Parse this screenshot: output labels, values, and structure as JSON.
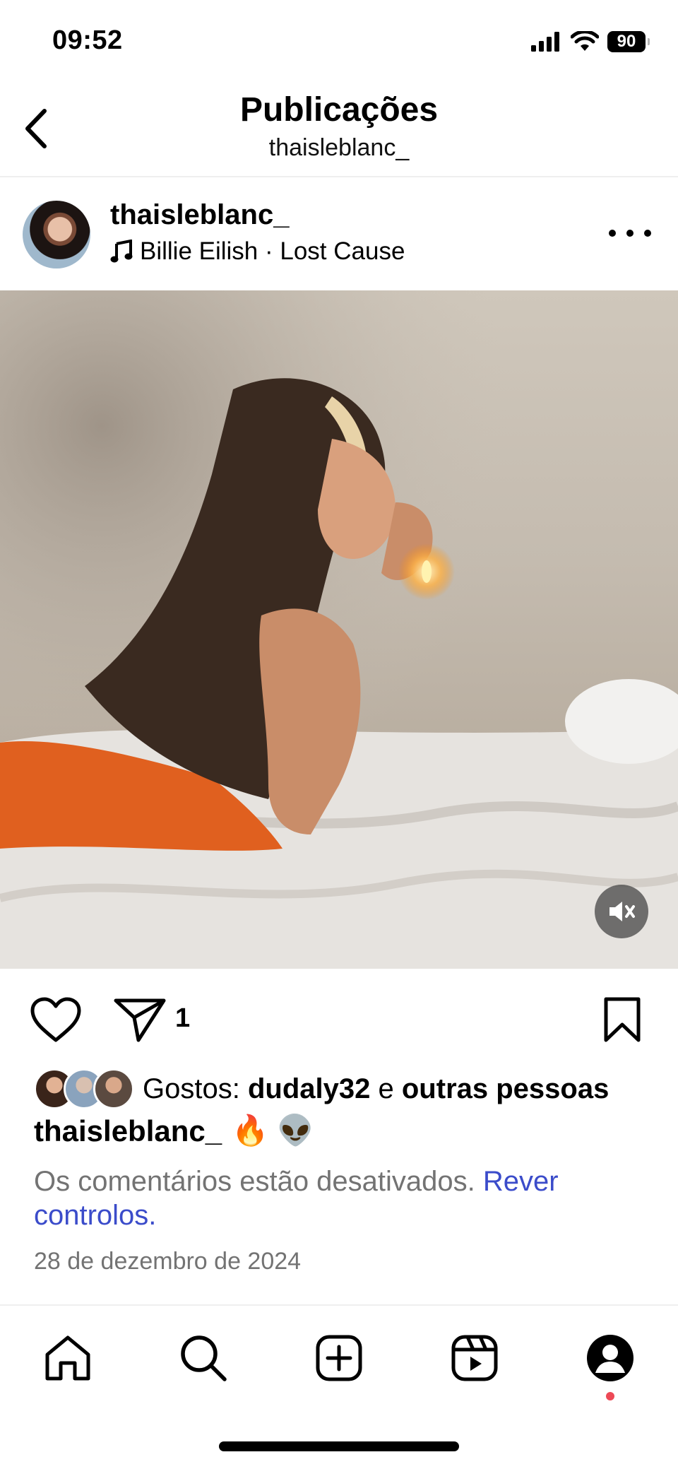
{
  "status_bar": {
    "time": "09:52",
    "battery": "90"
  },
  "header": {
    "title": "Publicações",
    "subtitle": "thaisleblanc_"
  },
  "post": {
    "username": "thaisleblanc_",
    "music": "Billie Eilish · Lost Cause",
    "share_count": "1",
    "likes": {
      "prefix": "Gostos:",
      "user": "dudaly32",
      "joiner": "e",
      "others": "outras pessoas"
    },
    "caption": {
      "username": "thaisleblanc_",
      "text": "🔥 👽"
    },
    "comments_note": {
      "text": "Os comentários estão desativados.",
      "link": "Rever controlos."
    },
    "date": "28 de dezembro de 2024"
  },
  "colors": {
    "link": "#3b4cca",
    "muted": "#737373",
    "notification_dot": "#ed4956"
  },
  "icons": {
    "back": "chevron-left-icon",
    "more": "more-icon",
    "music": "music-note-icon",
    "mute": "speaker-muted-icon",
    "like": "heart-icon",
    "share": "send-icon",
    "save": "bookmark-icon",
    "home": "home-icon",
    "search": "search-icon",
    "create": "create-icon",
    "reels": "reels-icon",
    "profile": "profile-icon"
  }
}
